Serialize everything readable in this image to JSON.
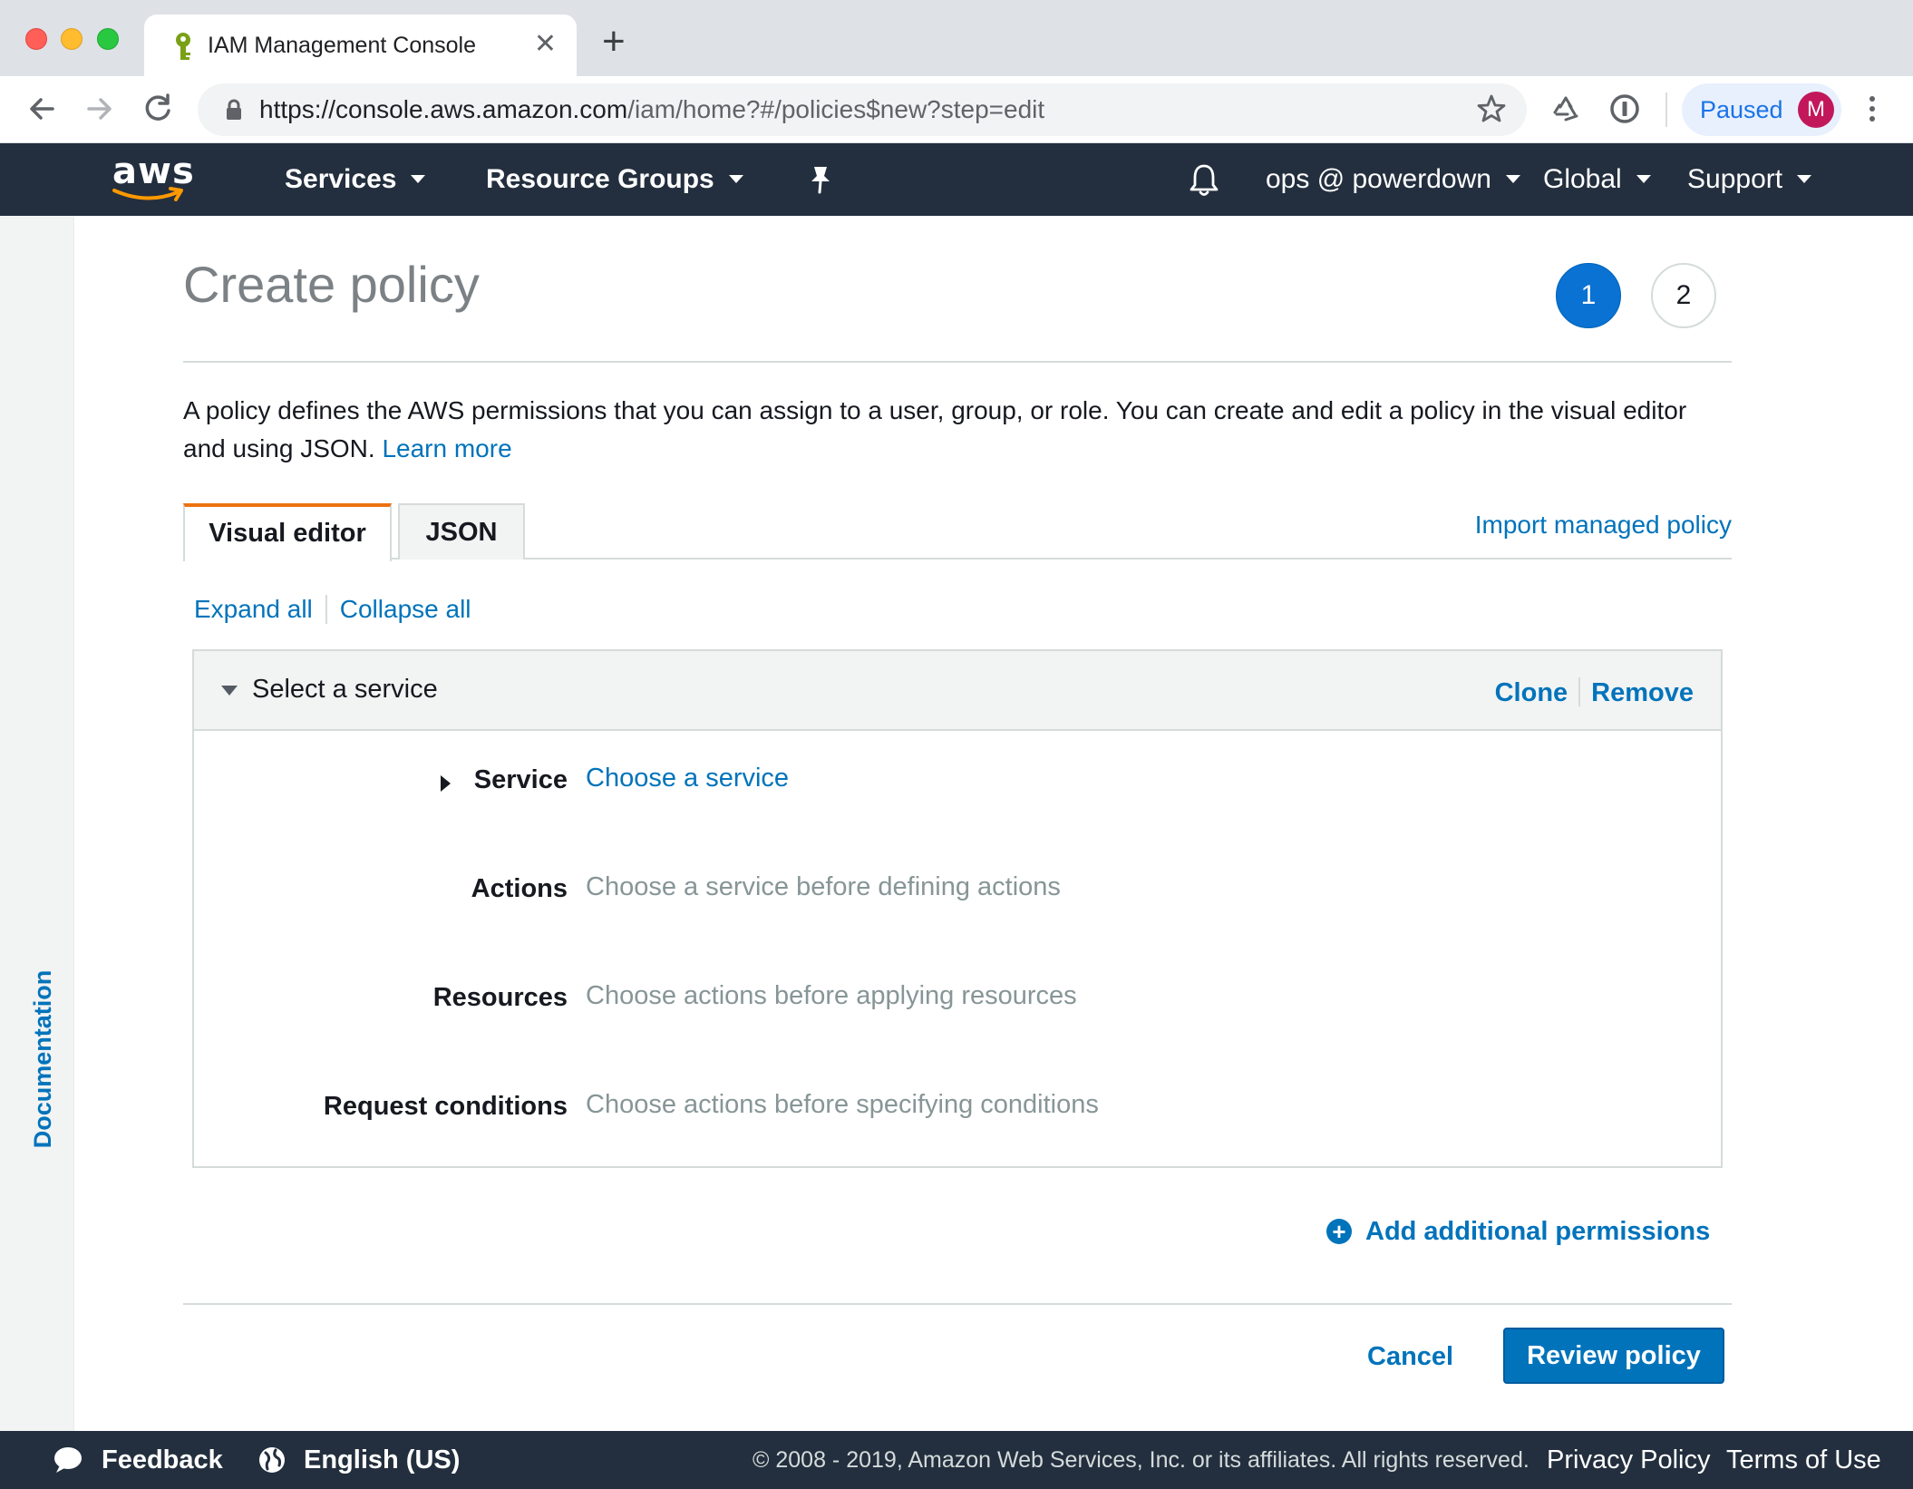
{
  "browser": {
    "tab_title": "IAM Management Console",
    "tab_close": "✕",
    "new_tab": "+",
    "url_host": "https://console.aws.amazon.com",
    "url_path": "/iam/home?#/policies$new?step=edit",
    "profile_status": "Paused",
    "profile_initial": "M"
  },
  "aws_nav": {
    "logo_text": "aws",
    "services": "Services",
    "resource_groups": "Resource Groups",
    "account": "ops @ powerdown",
    "region": "Global",
    "support": "Support"
  },
  "sidebar": {
    "documentation": "Documentation"
  },
  "page": {
    "title": "Create policy",
    "steps": [
      "1",
      "2"
    ],
    "description": "A policy defines the AWS permissions that you can assign to a user, group, or role. You can create and edit a policy in the visual editor and using JSON.",
    "learn_more": "Learn more",
    "tabs": [
      "Visual editor",
      "JSON"
    ],
    "import_link": "Import managed policy",
    "expand_all": "Expand all",
    "collapse_all": "Collapse all"
  },
  "panel": {
    "title": "Select a service",
    "clone": "Clone",
    "remove": "Remove",
    "fields": [
      {
        "label": "Service",
        "value": "Choose a service"
      },
      {
        "label": "Actions",
        "value": "Choose a service before defining actions"
      },
      {
        "label": "Resources",
        "value": "Choose actions before applying resources"
      },
      {
        "label": "Request conditions",
        "value": "Choose actions before specifying conditions"
      }
    ]
  },
  "actions": {
    "add_permissions": "Add additional permissions",
    "cancel": "Cancel",
    "review": "Review policy"
  },
  "footer": {
    "feedback": "Feedback",
    "language": "English (US)",
    "copyright": "© 2008 - 2019, Amazon Web Services, Inc. or its affiliates. All rights reserved.",
    "privacy": "Privacy Policy",
    "terms": "Terms of Use"
  },
  "colors": {
    "aws_nav_bg": "#232f3e",
    "aws_orange": "#ec7211",
    "link_blue": "#0073bb",
    "step_active": "#0972d3"
  }
}
